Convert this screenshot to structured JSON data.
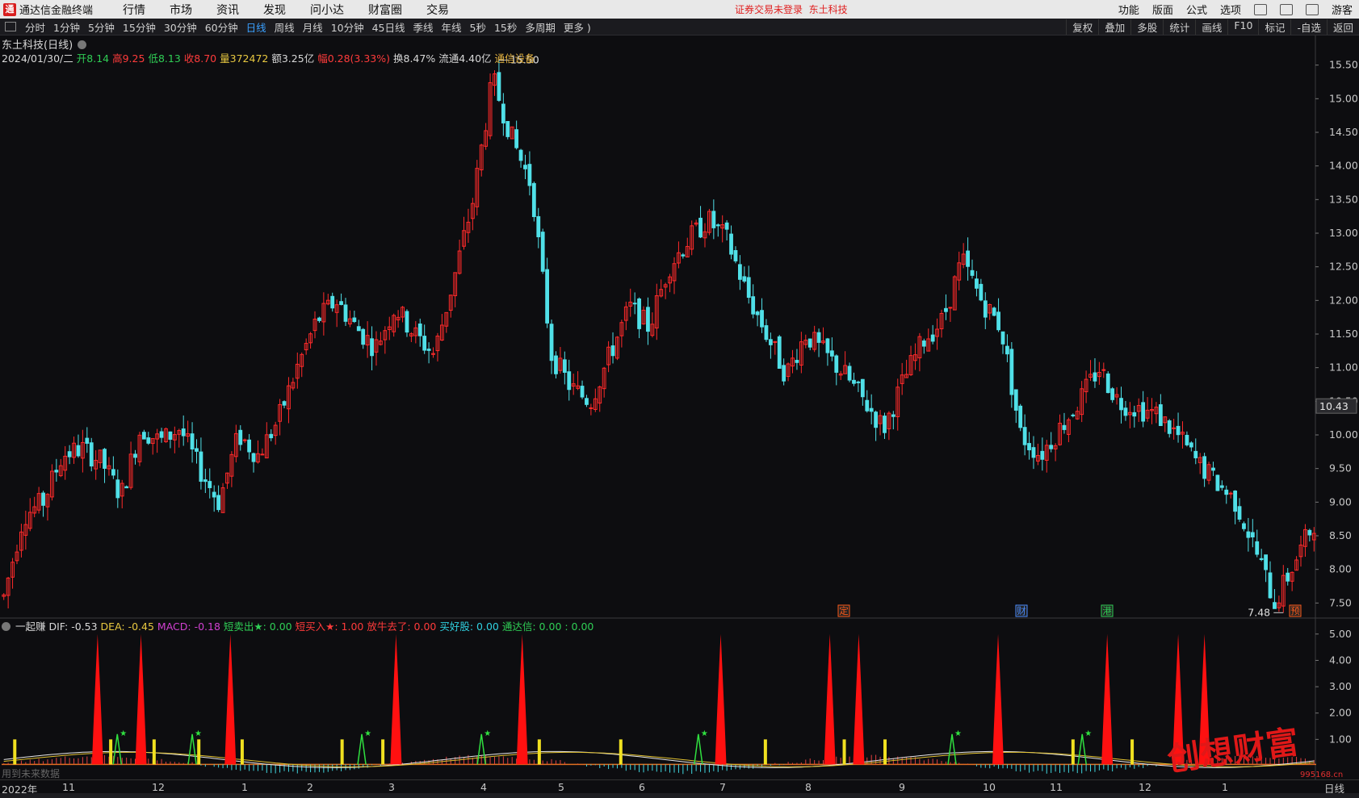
{
  "titlebar": {
    "app_name": "通达信金融终端",
    "menu": [
      "行情",
      "市场",
      "资讯",
      "发现",
      "问小达",
      "财富圈",
      "交易"
    ],
    "notice": "证券交易未登录",
    "notice_stock": "东土科技",
    "right_menu": [
      "功能",
      "版面",
      "公式",
      "选项"
    ],
    "user": "游客"
  },
  "periodbar": {
    "periods": [
      "分时",
      "1分钟",
      "5分钟",
      "15分钟",
      "30分钟",
      "60分钟",
      "日线",
      "周线",
      "月线",
      "10分钟",
      "45日线",
      "季线",
      "年线",
      "5秒",
      "15秒",
      "多周期",
      "更多 )"
    ],
    "active": "日线",
    "tools": [
      "复权",
      "叠加",
      "多股",
      "统计",
      "画线",
      "F10",
      "标记",
      "-自选",
      "返回"
    ]
  },
  "stock": {
    "title": "东土科技(日线)",
    "date": "2024/01/30/二",
    "open_label": "开",
    "open": "8.14",
    "high_label": "高",
    "high": "9.25",
    "low_label": "低",
    "low": "8.13",
    "close_label": "收",
    "close": "8.70",
    "vol_label": "量",
    "vol": "372472",
    "amount_label": "额",
    "amount": "3.25亿",
    "change_label": "幅",
    "change": "0.28(3.33%)",
    "turnover_label": "换",
    "turnover": "8.47%",
    "float_label": "流通",
    "float": "4.40亿",
    "sector": "通信设备"
  },
  "indicator": {
    "name": "一起赚",
    "dif": "DIF: -0.53",
    "dea": "DEA: -0.45",
    "macd": "MACD: -0.18",
    "s1": "短卖出★: 0.00",
    "s2": "短买入★: 1.00",
    "s3": "放牛去了: 0.00",
    "s4": "买好股: 0.00",
    "s5": "通达信: 0.00 : 0.00"
  },
  "future_note": "用到未来数据",
  "time_axis": [
    "2022年",
    "11",
    "12",
    "1",
    "2",
    "3",
    "4",
    "5",
    "6",
    "7",
    "8",
    "9",
    "10",
    "11",
    "12",
    "1"
  ],
  "period_label": "日线",
  "watermark": "创想财富",
  "watermark_url": "995168.cn",
  "chart_data": [
    {
      "type": "candlestick",
      "title": "东土科技(日线)",
      "ylim": [
        7.3,
        15.7
      ],
      "y_ticks": [
        "15.50",
        "15.00",
        "14.50",
        "14.00",
        "13.50",
        "13.00",
        "12.50",
        "12.00",
        "11.50",
        "11.00",
        "10.50",
        "10.00",
        "9.50",
        "9.00",
        "8.50",
        "8.00",
        "7.50"
      ],
      "current_price": "10.43",
      "max_label": "15.50",
      "min_label": "7.48",
      "event_markers": [
        {
          "label": "定",
          "color": "#ff5a1a"
        },
        {
          "label": "财",
          "color": "#4a8cff"
        },
        {
          "label": "港",
          "color": "#2fce55"
        },
        {
          "label": "预",
          "color": "#ff5a1a"
        }
      ],
      "close_path": [
        7.6,
        8.8,
        9.0,
        9.7,
        9.8,
        9.6,
        9.1,
        10.1,
        9.9,
        10.1,
        9.5,
        9.0,
        10.0,
        9.7,
        10.2,
        11.0,
        11.7,
        12.0,
        11.6,
        11.3,
        11.9,
        11.5,
        11.2,
        12.3,
        13.5,
        15.3,
        14.4,
        13.7,
        11.2,
        10.7,
        10.5,
        11.2,
        11.9,
        11.6,
        12.5,
        12.9,
        13.2,
        12.9,
        12.1,
        11.5,
        10.9,
        11.5,
        11.2,
        10.9,
        10.5,
        10.1,
        10.8,
        11.4,
        11.7,
        12.6,
        12.0,
        11.6,
        10.0,
        9.7,
        10.1,
        10.5,
        11.0,
        10.5,
        10.4,
        10.3,
        10.0,
        9.6,
        9.3,
        9.0,
        8.3,
        7.5,
        8.1,
        8.7
      ]
    },
    {
      "type": "indicator",
      "name": "一起赚",
      "ylim": [
        0,
        5.3
      ],
      "y_ticks": [
        "5.00",
        "4.00",
        "3.00",
        "2.00",
        "1.00"
      ],
      "spikes_positions_pct": [
        7.3,
        10.6,
        17.4,
        30.0,
        39.6,
        54.7,
        63.0,
        65.2,
        75.8,
        84.1,
        89.5,
        91.5
      ],
      "spike_value": 5.0
    }
  ]
}
